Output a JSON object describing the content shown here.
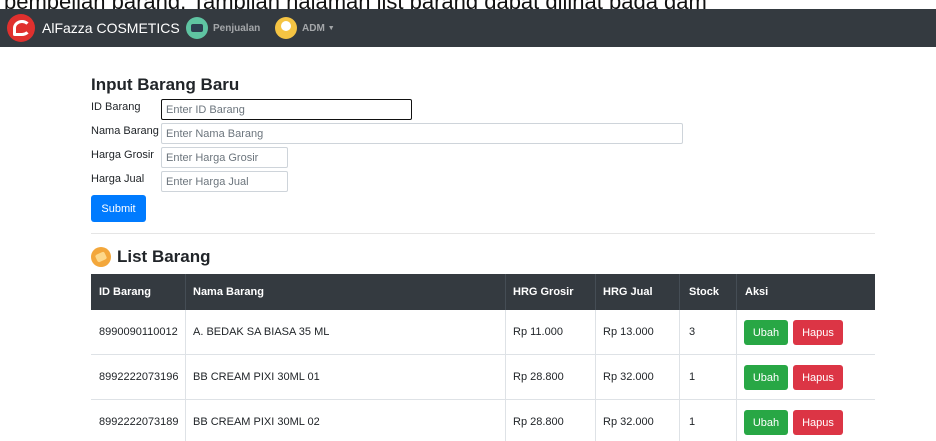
{
  "doc_caption": "pembelian barang. Tampilan halaman list barang dapat dilihat pada gam",
  "navbar": {
    "brand": "AlFazza COSMETICS",
    "items": [
      {
        "label": "Penjualan",
        "icon": "cash-register-icon"
      },
      {
        "label": "ADM",
        "icon": "admin-user-icon",
        "dropdown": true
      }
    ]
  },
  "form": {
    "title": "Input Barang Baru",
    "fields": [
      {
        "label": "ID Barang",
        "placeholder": "Enter ID Barang",
        "value": ""
      },
      {
        "label": "Nama Barang",
        "placeholder": "Enter Nama Barang",
        "value": ""
      },
      {
        "label": "Harga Grosir",
        "placeholder": "Enter Harga Grosir",
        "value": ""
      },
      {
        "label": "Harga Jual",
        "placeholder": "Enter Harga Jual",
        "value": ""
      }
    ],
    "submit_label": "Submit"
  },
  "list": {
    "title": "List Barang",
    "icon": "box-icon",
    "columns": [
      "ID Barang",
      "Nama Barang",
      "HRG Grosir",
      "HRG Jual",
      "Stock",
      "Aksi"
    ],
    "rows": [
      {
        "id": "8990090110012",
        "nama": "A. BEDAK SA BIASA 35 ML",
        "grosir": "Rp 11.000",
        "jual": "Rp 13.000",
        "stock": "3"
      },
      {
        "id": "8992222073196",
        "nama": "BB CREAM PIXI 30ML 01",
        "grosir": "Rp 28.800",
        "jual": "Rp 32.000",
        "stock": "1"
      },
      {
        "id": "8992222073189",
        "nama": "BB CREAM PIXI 30ML 02",
        "grosir": "Rp 28.800",
        "jual": "Rp 32.000",
        "stock": "1"
      }
    ],
    "ubah_label": "Ubah",
    "hapus_label": "Hapus"
  },
  "colors": {
    "navbar_bg": "#343a40",
    "primary": "#007bff",
    "success": "#28a745",
    "danger": "#dc3545",
    "brand_logo": "#e0302e"
  }
}
